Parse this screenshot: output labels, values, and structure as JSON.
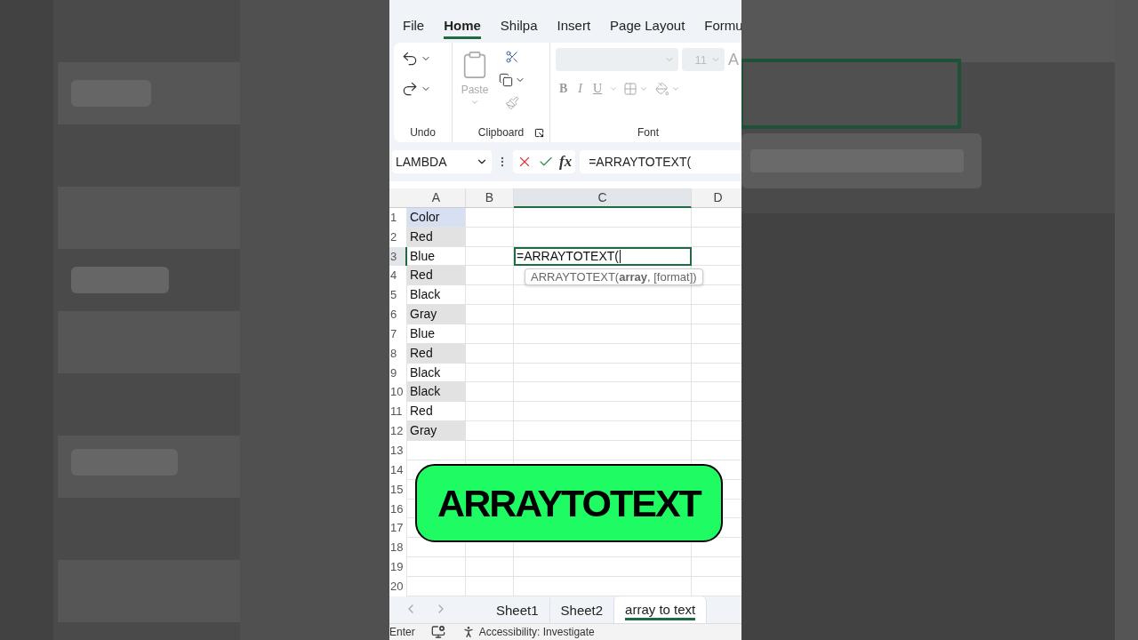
{
  "menu_tabs": [
    {
      "label": "File",
      "selected": false
    },
    {
      "label": "Home",
      "selected": true
    },
    {
      "label": "Shilpa",
      "selected": false
    },
    {
      "label": "Insert",
      "selected": false
    },
    {
      "label": "Page Layout",
      "selected": false
    },
    {
      "label": "Formu",
      "selected": false
    }
  ],
  "ribbon": {
    "undo_label": "Undo",
    "clipboard_label": "Clipboard",
    "paste_label": "Paste",
    "font_label": "Font",
    "font_size": "11",
    "grow_font": "A",
    "bold": "B",
    "italic": "I",
    "underline": "U"
  },
  "formula_bar": {
    "name_box": "LAMBDA",
    "function_button": "fx",
    "formula": "=ARRAYTOTEXT("
  },
  "columns": [
    {
      "label": "A",
      "selected": false
    },
    {
      "label": "B",
      "selected": false
    },
    {
      "label": "C",
      "selected": true
    },
    {
      "label": "D",
      "selected": false
    }
  ],
  "rows": [
    {
      "number": "1",
      "a": "Color",
      "selected": false,
      "shaded": false,
      "highlighted": true
    },
    {
      "number": "2",
      "a": "Red",
      "selected": false,
      "shaded": true,
      "highlighted": false
    },
    {
      "number": "3",
      "a": "Blue",
      "selected": true,
      "shaded": false,
      "highlighted": false
    },
    {
      "number": "4",
      "a": "Red",
      "selected": false,
      "shaded": true,
      "highlighted": false
    },
    {
      "number": "5",
      "a": "Black",
      "selected": false,
      "shaded": false,
      "highlighted": false
    },
    {
      "number": "6",
      "a": "Gray",
      "selected": false,
      "shaded": true,
      "highlighted": false
    },
    {
      "number": "7",
      "a": "Blue",
      "selected": false,
      "shaded": false,
      "highlighted": false
    },
    {
      "number": "8",
      "a": "Red",
      "selected": false,
      "shaded": true,
      "highlighted": false
    },
    {
      "number": "9",
      "a": "Black",
      "selected": false,
      "shaded": false,
      "highlighted": false
    },
    {
      "number": "10",
      "a": "Black",
      "selected": false,
      "shaded": true,
      "highlighted": false
    },
    {
      "number": "11",
      "a": "Red",
      "selected": false,
      "shaded": false,
      "highlighted": false
    },
    {
      "number": "12",
      "a": "Gray",
      "selected": false,
      "shaded": true,
      "highlighted": false
    },
    {
      "number": "13",
      "selected": false,
      "shaded": false,
      "highlighted": false
    },
    {
      "number": "14",
      "selected": false,
      "shaded": false,
      "highlighted": false
    },
    {
      "number": "15",
      "selected": false,
      "shaded": false,
      "highlighted": false
    },
    {
      "number": "16",
      "selected": false,
      "shaded": false,
      "highlighted": false
    },
    {
      "number": "17",
      "selected": false,
      "shaded": false,
      "highlighted": false
    },
    {
      "number": "18",
      "selected": false,
      "shaded": false,
      "highlighted": false
    },
    {
      "number": "19",
      "selected": false,
      "shaded": false,
      "highlighted": false
    },
    {
      "number": "20",
      "selected": false,
      "shaded": false,
      "highlighted": false
    }
  ],
  "active_cell": {
    "value": "=ARRAYTOTEXT(",
    "tooltip": "ARRAYTOTEXT(**array**, [format])"
  },
  "banner": {
    "text": "ARRAYTOTEXT"
  },
  "sheet_tabs": [
    {
      "label": "Sheet1",
      "selected": false
    },
    {
      "label": "Sheet2",
      "selected": false
    },
    {
      "label": "array to text",
      "selected": true
    }
  ],
  "status_bar": {
    "mode": "Enter",
    "accessibility": "Accessibility: Investigate"
  }
}
